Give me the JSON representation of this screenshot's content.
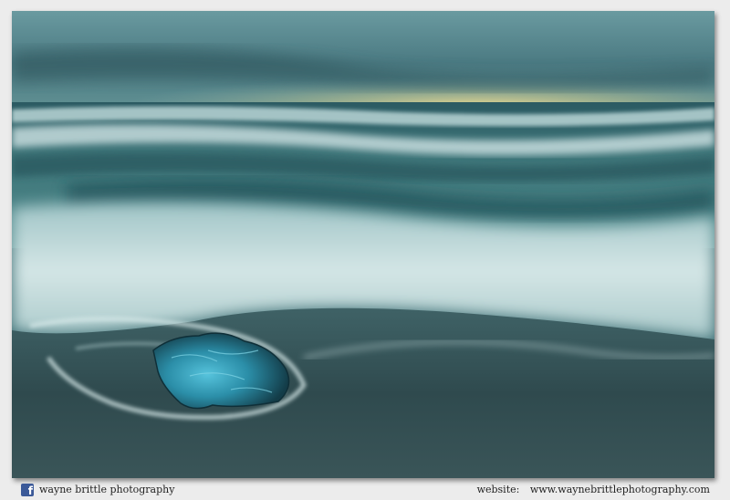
{
  "footer": {
    "brand": "wayne brittle photography",
    "website_label": "website:",
    "website_url": "www.waynebrittlephotography.com",
    "facebook_icon": "facebook-icon"
  },
  "photo": {
    "subject": "ice-chunk-on-black-sand-beach",
    "colors": {
      "sky": "#4f7f86",
      "horizon_glow": "#e9d48a",
      "sea": "#2f6469",
      "surf": "#cfe3e4",
      "sand": "#2a3d40",
      "ice": "#2fa8c8"
    }
  }
}
